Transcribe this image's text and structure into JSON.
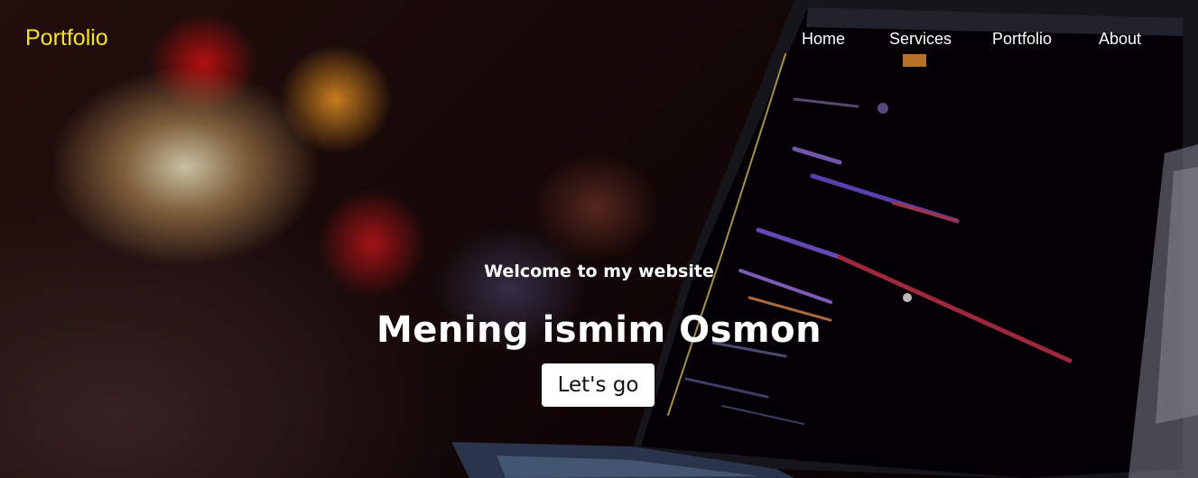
{
  "navbar": {
    "logo": "Portfolio",
    "links": [
      {
        "label": "Home"
      },
      {
        "label": "Services"
      },
      {
        "label": "Portfolio"
      },
      {
        "label": "About"
      }
    ]
  },
  "hero": {
    "welcome": "Welcome to my website",
    "title": "Mening ismim Osmon",
    "button_label": "Let's go"
  },
  "colors": {
    "logo": "#f5e41e",
    "nav_text": "#ffffff",
    "button_bg": "#ffffff",
    "button_text": "#111111"
  }
}
